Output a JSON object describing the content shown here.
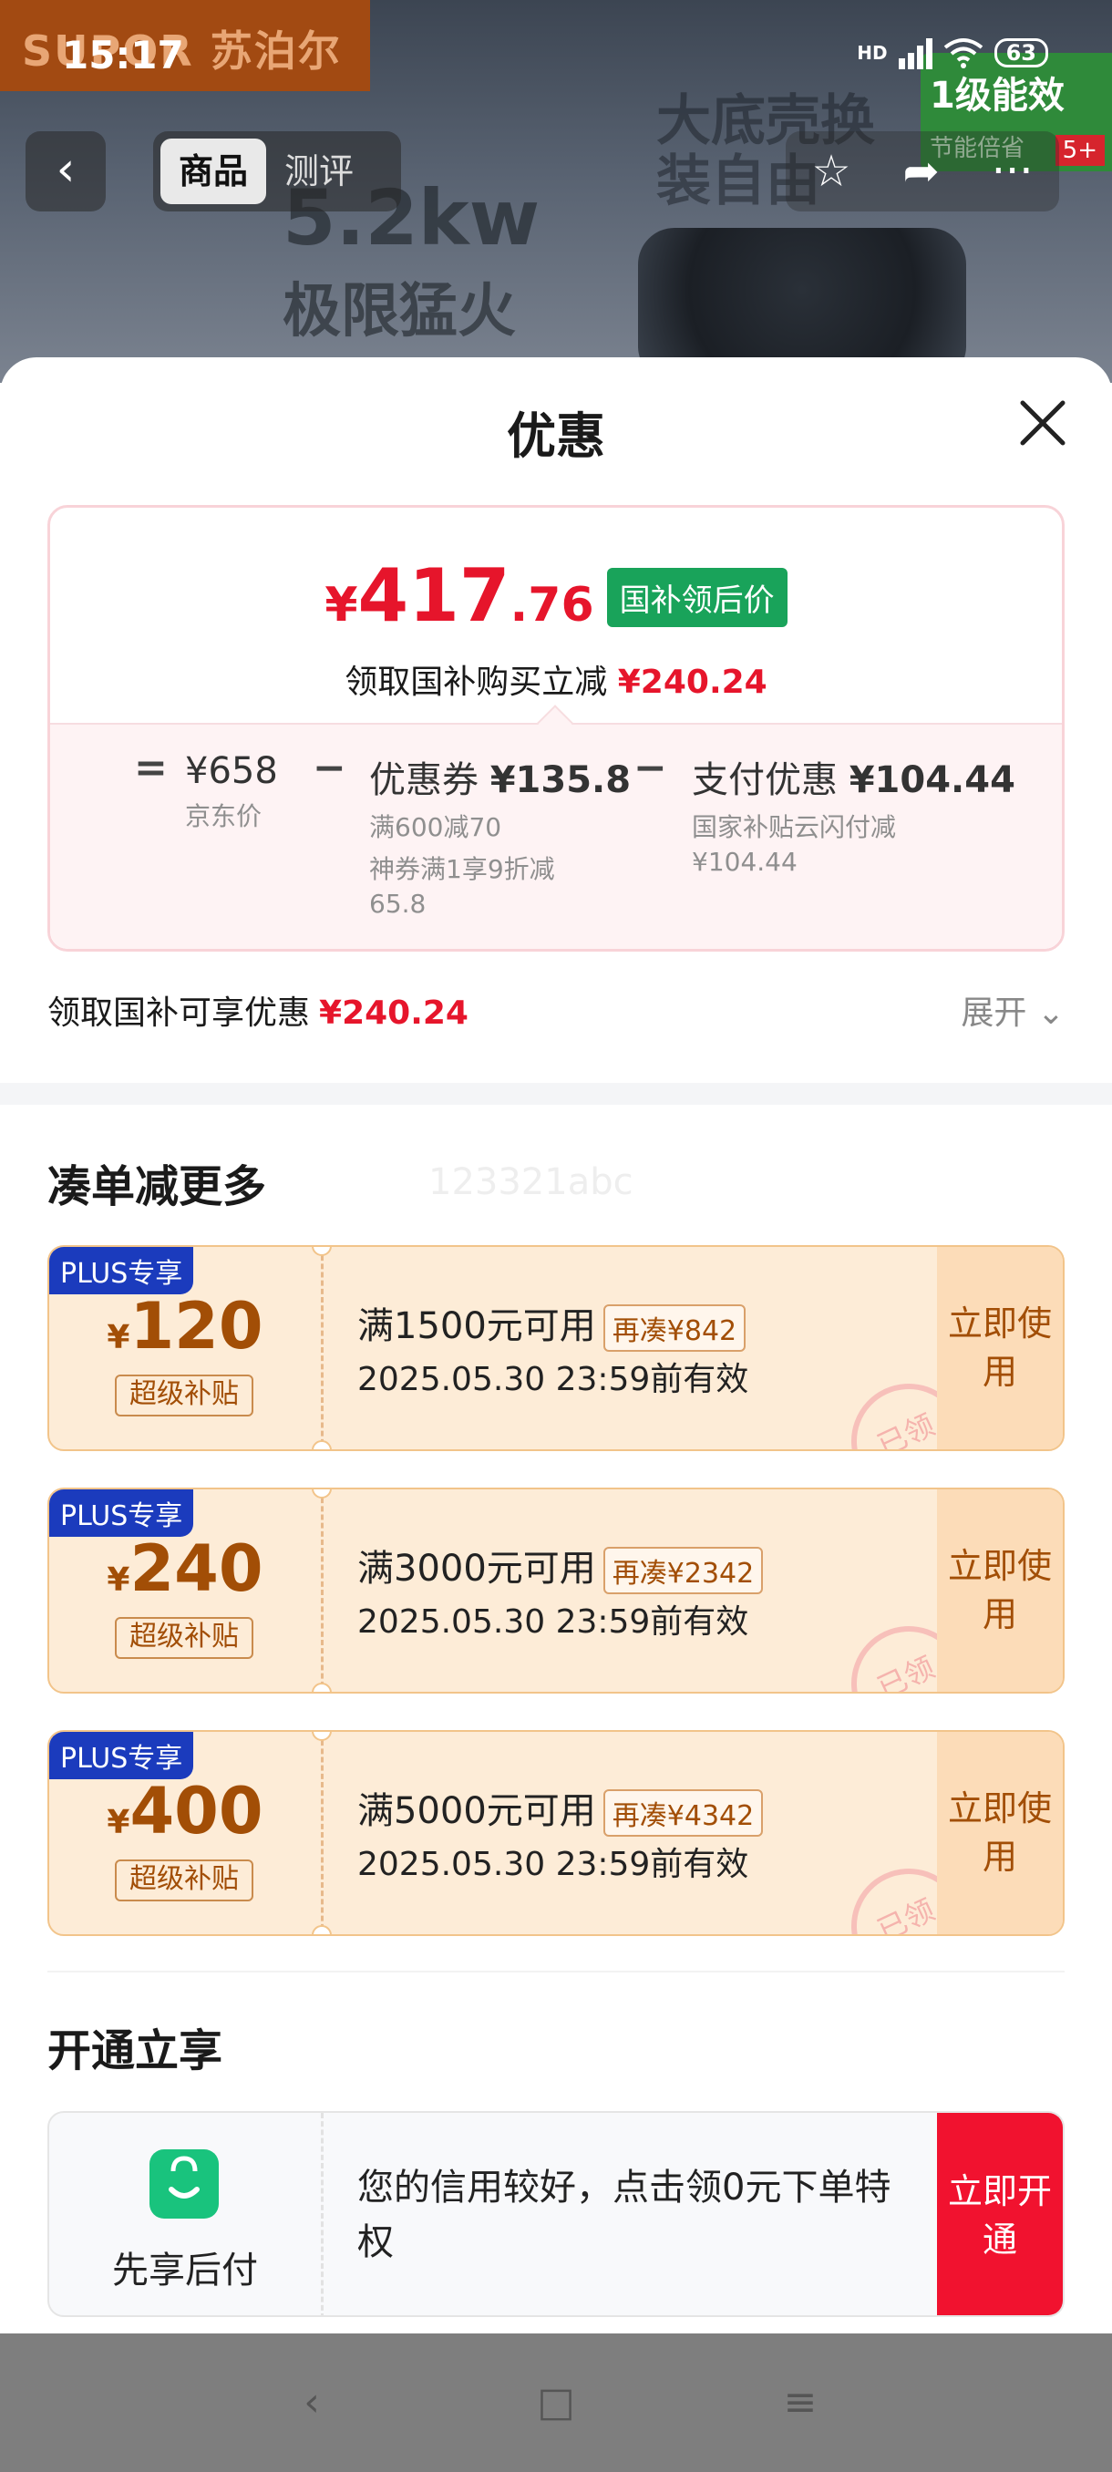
{
  "status_bar": {
    "time": "15:17",
    "hd": "HD",
    "battery": "63"
  },
  "background_page": {
    "brand": "SUPOR 苏泊尔",
    "energy_label": "1级能效",
    "energy_sub": "节能倍省",
    "energy_badge": "5+",
    "promo_power": "5.2kw",
    "promo_fire": "极限猛火",
    "promo_shell": "大底壳换装自由",
    "nav_back": "‹",
    "tabs": [
      "商品",
      "测评"
    ],
    "actions": [
      "☆",
      "➦",
      "···"
    ]
  },
  "sheet": {
    "title": "优惠",
    "price_summary": {
      "yen": "¥",
      "integer": "417",
      "decimal": ".76",
      "tag": "国补领后价",
      "subtitle": "领取国补购买立减",
      "subtitle_amount": "¥240.24"
    },
    "formula": {
      "equals": "=",
      "minus": "−",
      "base_price": "¥658",
      "base_label": "京东价",
      "coupon_title": "优惠券",
      "coupon_amount": "¥135.8",
      "coupon_lines": [
        "满600减70",
        "神券满1享9折减",
        "65.8"
      ],
      "pay_title": "支付优惠",
      "pay_amount": "¥104.44",
      "pay_lines": [
        "国家补贴云闪付减",
        "¥104.44"
      ]
    },
    "gov_line": {
      "label": "领取国补可享优惠",
      "amount": "¥240.24",
      "expand": "展开"
    },
    "combine_section": {
      "title": "凑单减更多",
      "watermark": "123321abc",
      "coupons": [
        {
          "badge": "PLUS专享",
          "yen": "¥",
          "amount": "120",
          "tag": "超级补贴",
          "condition": "满1500元可用",
          "more": "再凑¥842",
          "expiry": "2025.05.30 23:59前有效",
          "stamp": "已领",
          "use": "立即使用"
        },
        {
          "badge": "PLUS专享",
          "yen": "¥",
          "amount": "240",
          "tag": "超级补贴",
          "condition": "满3000元可用",
          "more": "再凑¥2342",
          "expiry": "2025.05.30 23:59前有效",
          "stamp": "已领",
          "use": "立即使用"
        },
        {
          "badge": "PLUS专享",
          "yen": "¥",
          "amount": "400",
          "tag": "超级补贴",
          "condition": "满5000元可用",
          "more": "再凑¥4342",
          "expiry": "2025.05.30 23:59前有效",
          "stamp": "已领",
          "use": "立即使用"
        }
      ]
    },
    "open_section": {
      "title": "开通立享",
      "label": "先享后付",
      "message": "您的信用较好，点击领0元下单特权",
      "button": "立即开通"
    }
  },
  "colors": {
    "price_red": "#e6152b",
    "green_tag": "#19a35a",
    "plus_blue": "#1b3bbd",
    "coupon_bg": "#fdecd7",
    "open_red": "#f1122f"
  },
  "system_nav": {
    "back": "‹",
    "home": "□",
    "menu": "≡"
  }
}
